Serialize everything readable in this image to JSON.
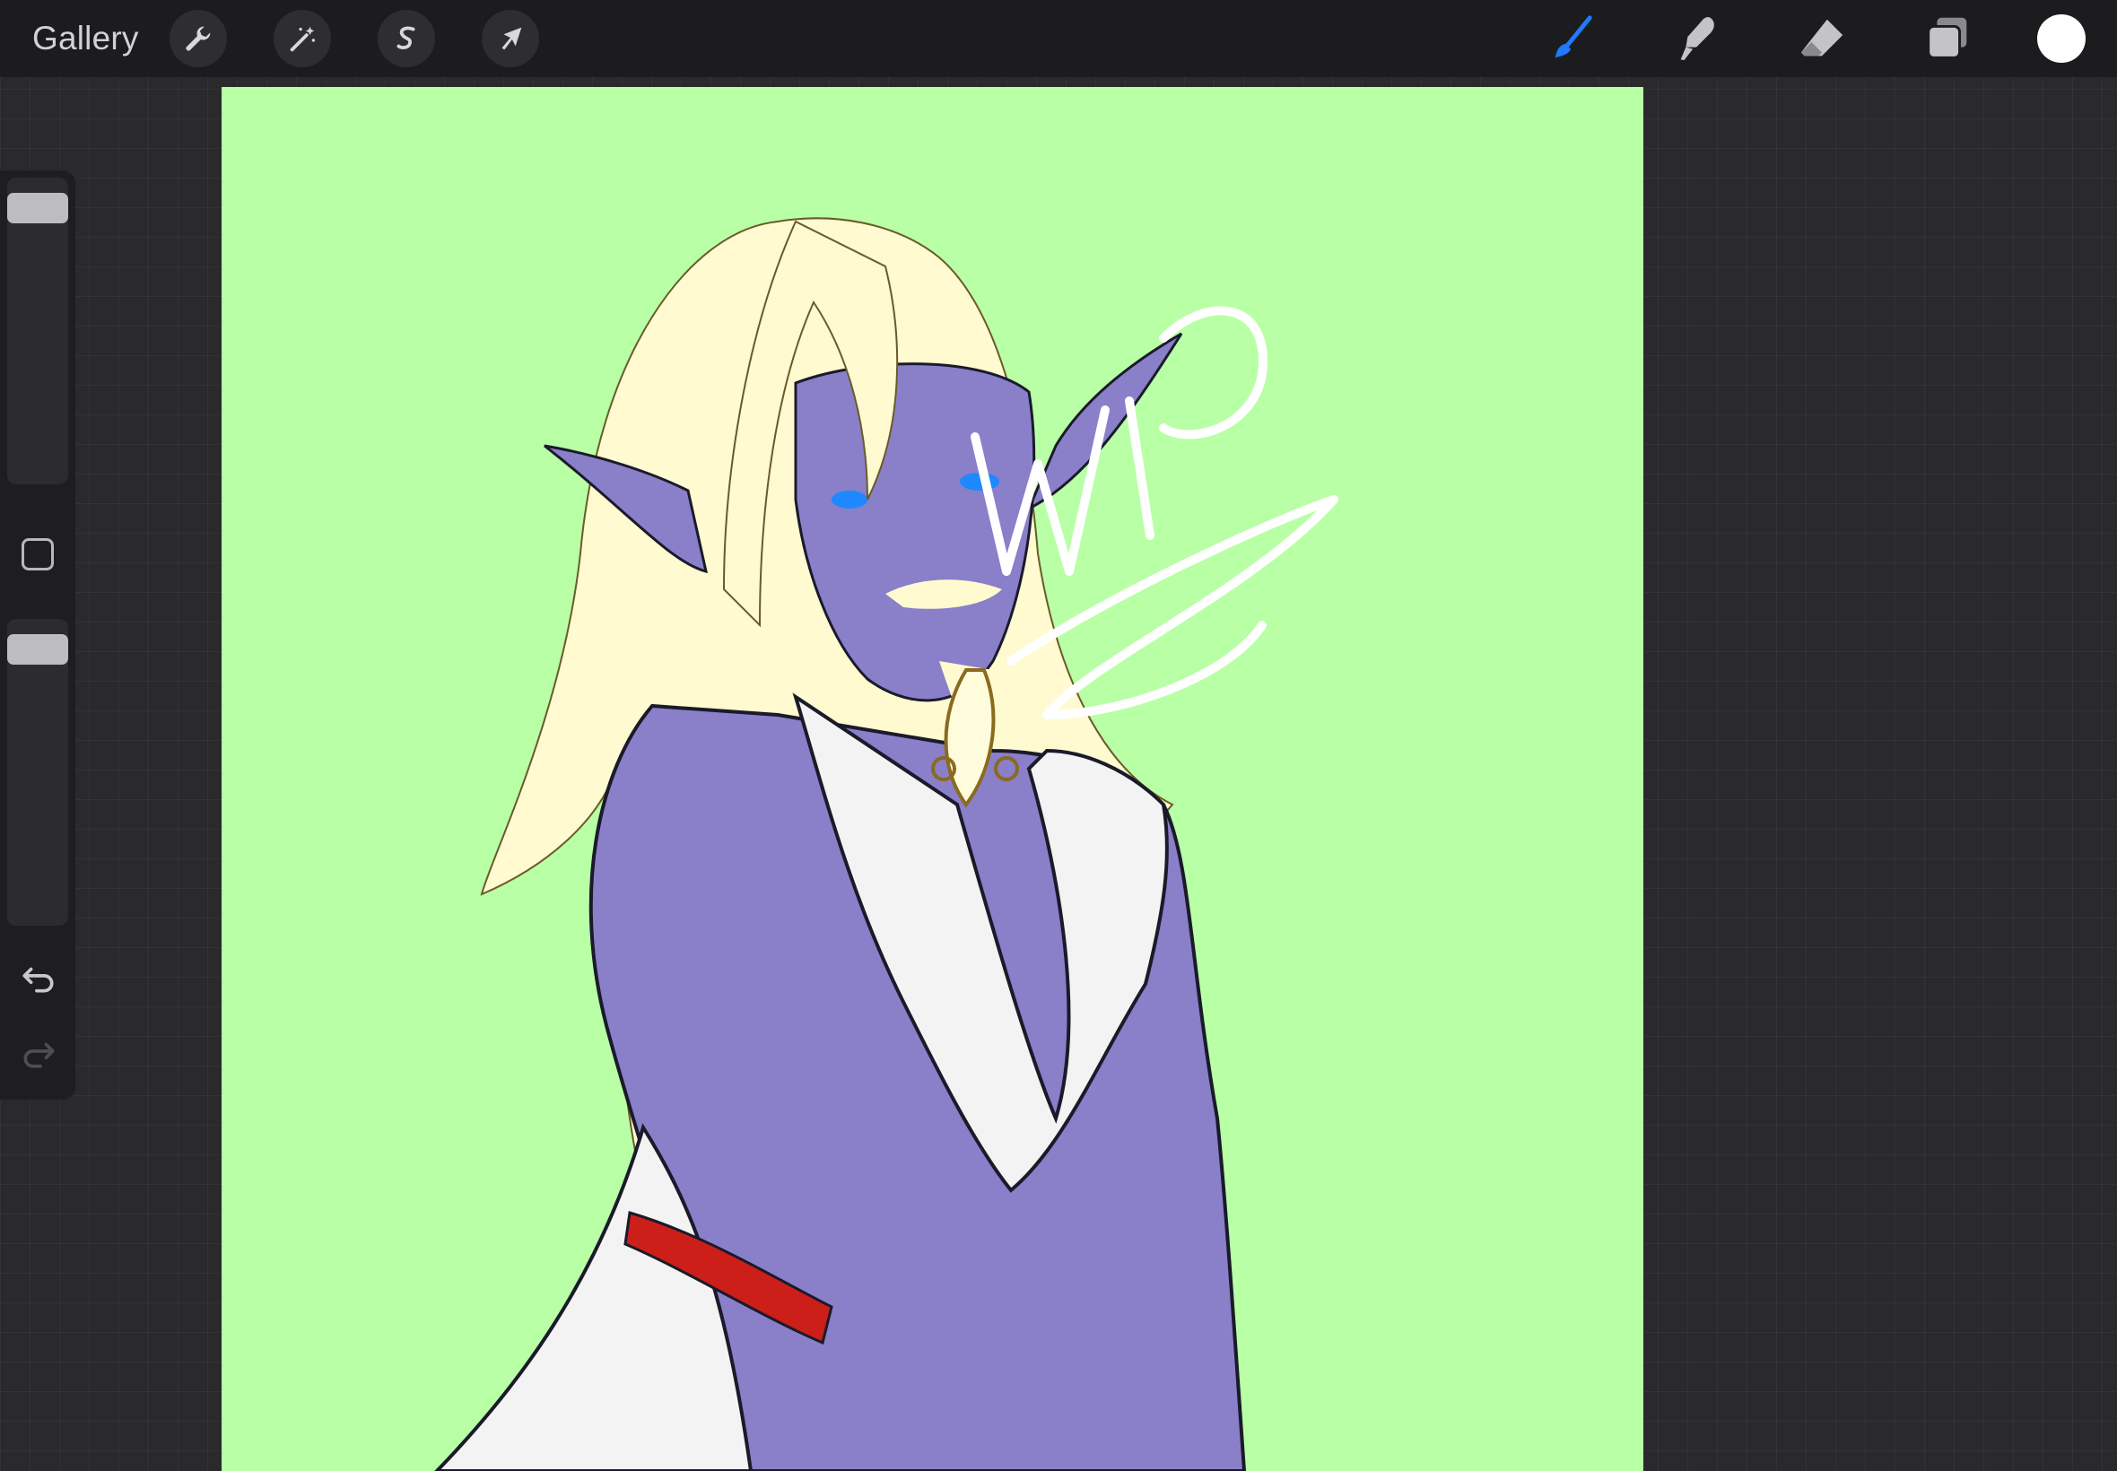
{
  "topbar": {
    "gallery_label": "Gallery",
    "left_tools": [
      {
        "name": "actions",
        "icon": "wrench-icon"
      },
      {
        "name": "adjustments",
        "icon": "magic-wand-icon"
      },
      {
        "name": "selection",
        "icon": "selection-s-icon"
      },
      {
        "name": "transform",
        "icon": "arrow-cursor-icon"
      }
    ],
    "right_tools": [
      {
        "name": "brush",
        "icon": "brush-icon",
        "active": true,
        "color": "#1f7aff"
      },
      {
        "name": "smudge",
        "icon": "smudge-finger-icon"
      },
      {
        "name": "eraser",
        "icon": "eraser-icon"
      },
      {
        "name": "layers",
        "icon": "layers-icon"
      }
    ],
    "current_color": "#ffffff"
  },
  "sidebar": {
    "brush_size": 0.95,
    "opacity": 0.95,
    "undo_icon": "undo-icon",
    "redo_icon": "redo-icon",
    "redo_enabled": false,
    "modify_icon": "square-modify-icon"
  },
  "canvas": {
    "background_color": "#b8ffa6",
    "skin_color": "#8a7fc9",
    "hair_color": "#fffad0",
    "robe_color": "#f2f2f2",
    "belt_color": "#cc1f1a",
    "eye_color": "#1e88ff",
    "scribble": "WIP"
  }
}
